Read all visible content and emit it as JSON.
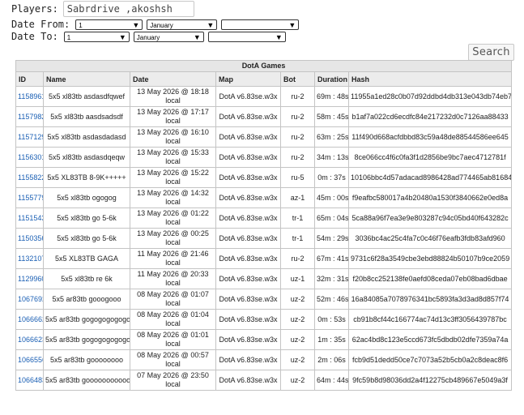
{
  "filters": {
    "players_label": "Players:",
    "players_value": "Sabrdrive ,akoshsh",
    "date_from_label": "Date From:",
    "date_to_label": "Date To:",
    "from": {
      "day": "1",
      "month": "January",
      "year": ""
    },
    "to": {
      "day": "1",
      "month": "January",
      "year": ""
    },
    "search_label": "Search"
  },
  "table": {
    "title": "DotA Games",
    "headers": [
      "ID",
      "Name",
      "Date",
      "Map",
      "Bot",
      "Duration",
      "Hash"
    ],
    "rows": [
      {
        "id": "1158961",
        "name": "5x5 xl83tb asdasdfqwef",
        "date": "13 May 2026 @ 18:18",
        "tz": "local",
        "map": "DotA v6.83se.w3x",
        "bot": "ru-2",
        "duration": "69m : 48s",
        "hash": "11955a1ed28c0b07d92ddbd4db313e043db74eb7"
      },
      {
        "id": "1157982",
        "name": "5x5 xl83tb aasdsadsdf",
        "date": "13 May 2026 @ 17:17",
        "tz": "local",
        "map": "DotA v6.83se.w3x",
        "bot": "ru-2",
        "duration": "58m : 45s",
        "hash": "b1af7a022cd6ecdfc84e217232d0c7126aa88433"
      },
      {
        "id": "1157129",
        "name": "5x5 xl83tb asdasdadasd",
        "date": "13 May 2026 @ 16:10",
        "tz": "local",
        "map": "DotA v6.83se.w3x",
        "bot": "ru-2",
        "duration": "63m : 25s",
        "hash": "11f490d668acfdbbd83c59a48de88544586ee645"
      },
      {
        "id": "1156301",
        "name": "5x5 xl83tb asdasdqeqw",
        "date": "13 May 2026 @ 15:33",
        "tz": "local",
        "map": "DotA v6.83se.w3x",
        "bot": "ru-2",
        "duration": "34m : 13s",
        "hash": "8ce066cc4f6c0fa3f1d2856be9bc7aec4712781f"
      },
      {
        "id": "1155822",
        "name": "5x5 XL83TB 8-9K+++++",
        "date": "13 May 2026 @ 15:22",
        "tz": "local",
        "map": "DotA v6.83se.w3x",
        "bot": "ru-5",
        "duration": "0m : 37s",
        "hash": "10106bbc4d57adacad8986428ad774465ab81684"
      },
      {
        "id": "1155779",
        "name": "5x5 xl83tb ogogog",
        "date": "13 May 2026 @ 14:32",
        "tz": "local",
        "map": "DotA v6.83se.w3x",
        "bot": "az-1",
        "duration": "45m : 00s",
        "hash": "f9eafbc580017a4b20480a1530f3840662e0ed8a"
      },
      {
        "id": "1151543",
        "name": "5x5 xl83tb go 5-6k",
        "date": "13 May 2026 @ 01:22",
        "tz": "local",
        "map": "DotA v6.83se.w3x",
        "bot": "tr-1",
        "duration": "65m : 04s",
        "hash": "5ca88a96f7ea3e9e803287c94c05bd40f643282c"
      },
      {
        "id": "1150356",
        "name": "5x5 xl83tb go 5-6k",
        "date": "13 May 2026 @ 00:25",
        "tz": "local",
        "map": "DotA v6.83se.w3x",
        "bot": "tr-1",
        "duration": "54m : 29s",
        "hash": "3036bc4ac25c4fa7c0c46f76eafb3fdb83afd960"
      },
      {
        "id": "1132107",
        "name": "5x5 XL83TB GAGA",
        "date": "11 May 2026 @ 21:46",
        "tz": "local",
        "map": "DotA v6.83se.w3x",
        "bot": "ru-2",
        "duration": "67m : 41s",
        "hash": "9731c6f28a3549cbe3ebd88824b50107b9ce2059"
      },
      {
        "id": "1129960",
        "name": "5x5 xl83tb re 6k",
        "date": "11 May 2026 @ 20:33",
        "tz": "local",
        "map": "DotA v6.83se.w3x",
        "bot": "uz-1",
        "duration": "32m : 31s",
        "hash": "f20b8cc252138fe0aefd08ceda07eb08bad6dbae"
      },
      {
        "id": "1067692",
        "name": "5x5 ar83tb gooogooo",
        "date": "08 May 2026 @ 01:07",
        "tz": "local",
        "map": "DotA v6.83se.w3x",
        "bot": "uz-2",
        "duration": "52m : 46s",
        "hash": "16a84085a7078976341bc5893fa3d3ad8d857f74"
      },
      {
        "id": "1066662",
        "name": "5x5 ar83tb gogogogogogo",
        "date": "08 May 2026 @ 01:04",
        "tz": "local",
        "map": "DotA v6.83se.w3x",
        "bot": "uz-2",
        "duration": "0m : 53s",
        "hash": "cb91b8cf44c166774ac74d13c3ff3056439787bc"
      },
      {
        "id": "1066623",
        "name": "5x5 ar83tb gogogogogogo",
        "date": "08 May 2026 @ 01:01",
        "tz": "local",
        "map": "DotA v6.83se.w3x",
        "bot": "uz-2",
        "duration": "1m : 35s",
        "hash": "62ac4bd8c123e5ccd673fc5dbdb02dfe7359a74a"
      },
      {
        "id": "1066556",
        "name": "5x5 ar83tb goooooooo",
        "date": "08 May 2026 @ 00:57",
        "tz": "local",
        "map": "DotA v6.83se.w3x",
        "bot": "uz-2",
        "duration": "2m : 06s",
        "hash": "fcb9d51dedd50ce7c7073a52b5cb0a2c8deac8f6"
      },
      {
        "id": "1066483",
        "name": "5x5 ar83tb goooooooooooo",
        "date": "07 May 2026 @ 23:50",
        "tz": "local",
        "map": "DotA v6.83se.w3x",
        "bot": "uz-2",
        "duration": "64m : 44s",
        "hash": "9fc59b8d98036dd2a4f12275cb489667e5049a3f"
      }
    ]
  }
}
